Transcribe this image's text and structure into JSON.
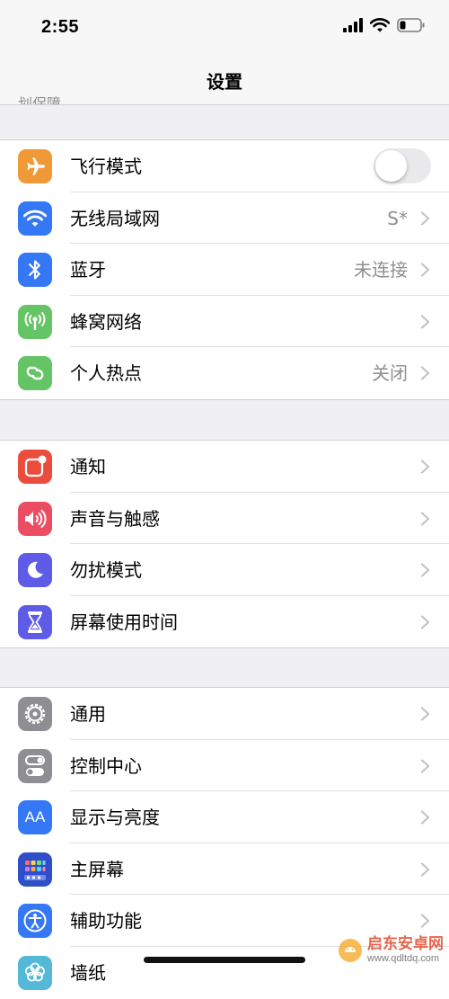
{
  "status_bar": {
    "time": "2:55"
  },
  "nav": {
    "title": "设置",
    "cutoff_text": "划保障。"
  },
  "groups": [
    {
      "rows": [
        {
          "label": "飞行模式",
          "icon": "airplane-icon",
          "color": "#f09a37",
          "control": "toggle",
          "toggle_on": false
        },
        {
          "label": "无线局域网",
          "icon": "wifi-icon",
          "color": "#3478f6",
          "value": "S*"
        },
        {
          "label": "蓝牙",
          "icon": "bluetooth-icon",
          "color": "#3478f6",
          "value": "未连接"
        },
        {
          "label": "蜂窝网络",
          "icon": "cellular-antenna-icon",
          "color": "#65c466"
        },
        {
          "label": "个人热点",
          "icon": "hotspot-chain-icon",
          "color": "#65c466",
          "value": "关闭"
        }
      ]
    },
    {
      "rows": [
        {
          "label": "通知",
          "icon": "notifications-icon",
          "color": "#eb4d3d"
        },
        {
          "label": "声音与触感",
          "icon": "speaker-icon",
          "color": "#eb4e63"
        },
        {
          "label": "勿扰模式",
          "icon": "moon-icon",
          "color": "#5e5ce6"
        },
        {
          "label": "屏幕使用时间",
          "icon": "hourglass-icon",
          "color": "#5e5ce6"
        }
      ]
    },
    {
      "rows": [
        {
          "label": "通用",
          "icon": "gear-icon",
          "color": "#8e8e93"
        },
        {
          "label": "控制中心",
          "icon": "control-center-icon",
          "color": "#8e8e93"
        },
        {
          "label": "显示与亮度",
          "icon": "display-text-icon",
          "color": "#3478f6",
          "icon_text": "AA"
        },
        {
          "label": "主屏幕",
          "icon": "home-screen-icon",
          "color": "#2f4fc8"
        },
        {
          "label": "辅助功能",
          "icon": "accessibility-icon",
          "color": "#3478f6"
        },
        {
          "label": "墙纸",
          "icon": "wallpaper-flower-icon",
          "color": "#54b8d8"
        }
      ]
    }
  ],
  "watermark": {
    "name": "启东安卓网",
    "url": "www.qdltdq.com"
  }
}
